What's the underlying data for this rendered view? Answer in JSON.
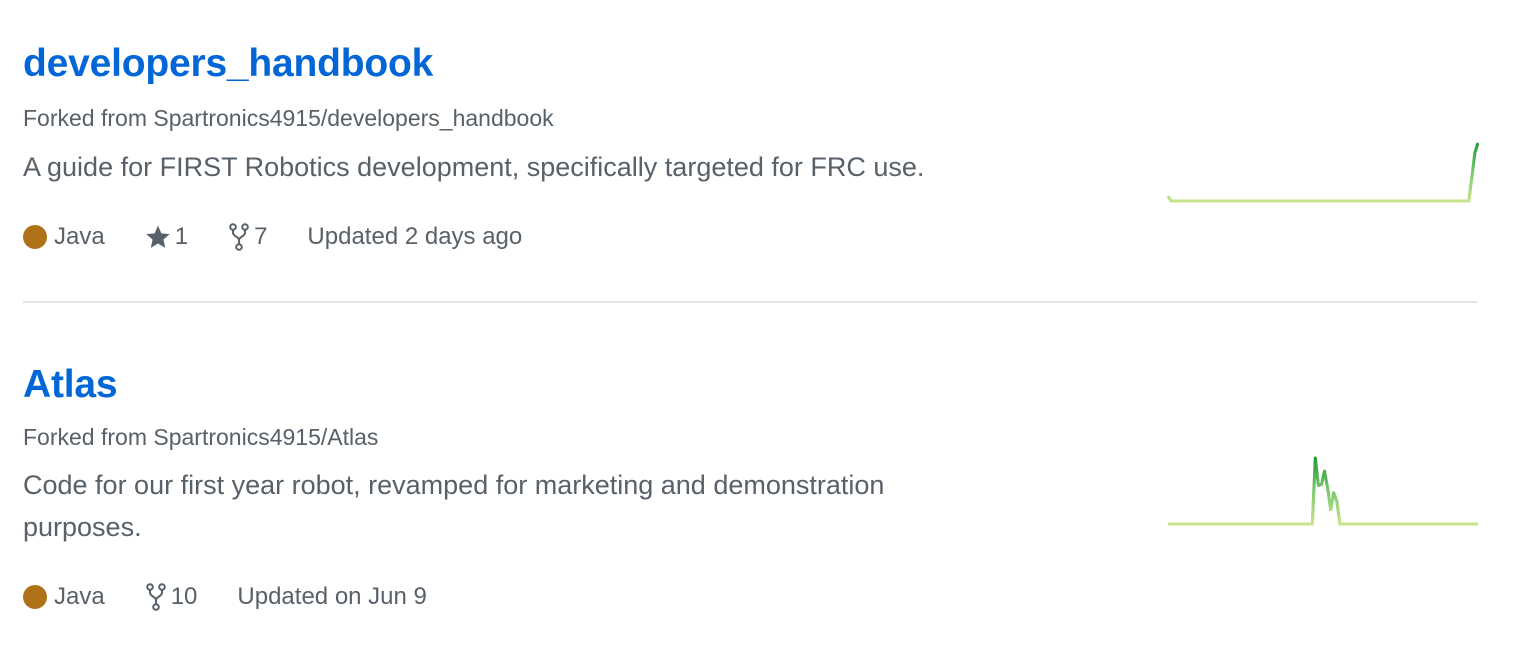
{
  "repos": [
    {
      "name": "developers_handbook",
      "forked_prefix": "Forked from ",
      "forked_from": "Spartronics4915/developers_handbook",
      "description": "A guide for FIRST Robotics development, specifically targeted for FRC use.",
      "language": "Java",
      "language_color": "#b07219",
      "stars": "1",
      "forks": "7",
      "updated": "Updated 2 days ago",
      "activity": [
        1,
        0,
        0,
        0,
        0,
        0,
        0,
        0,
        0,
        0,
        0,
        0,
        0,
        0,
        0,
        0,
        0,
        0,
        0,
        0,
        0,
        0,
        0,
        0,
        0,
        0,
        0,
        0,
        0,
        0,
        0,
        0,
        0,
        0,
        0,
        0,
        0,
        0,
        0,
        0,
        0,
        0,
        0,
        0,
        0,
        0,
        0,
        0,
        0,
        0,
        0,
        0,
        0,
        0,
        0,
        0,
        0,
        0,
        0,
        0,
        0,
        0,
        0,
        0,
        0,
        0,
        0,
        0,
        0,
        0,
        0,
        0,
        0,
        0,
        0,
        0,
        0,
        0,
        0,
        0,
        0,
        0,
        0,
        0,
        0,
        0,
        0,
        0,
        0,
        0,
        0,
        0,
        0,
        0,
        0,
        0,
        0,
        0,
        0,
        5,
        10,
        12
      ]
    },
    {
      "name": "Atlas",
      "forked_prefix": "Forked from ",
      "forked_from": "Spartronics4915/Atlas",
      "description": "Code for our first year robot, revamped for marketing and demonstration purposes.",
      "language": "Java",
      "language_color": "#b07219",
      "forks": "10",
      "updated": "Updated on Jun 9",
      "activity": [
        0,
        0,
        0,
        0,
        0,
        0,
        0,
        0,
        0,
        0,
        0,
        0,
        0,
        0,
        0,
        0,
        0,
        0,
        0,
        0,
        0,
        0,
        0,
        0,
        0,
        0,
        0,
        0,
        0,
        0,
        0,
        0,
        0,
        0,
        0,
        0,
        0,
        0,
        0,
        0,
        0,
        0,
        0,
        0,
        0,
        0,
        0,
        0,
        55,
        32,
        33,
        44,
        30,
        12,
        26,
        19,
        0,
        0,
        0,
        0,
        0,
        0,
        0,
        0,
        0,
        0,
        0,
        0,
        0,
        0,
        0,
        0,
        0,
        0,
        0,
        0,
        0,
        0,
        0,
        0,
        0,
        0,
        0,
        0,
        0,
        0,
        0,
        0,
        0,
        0,
        0,
        0,
        0,
        0,
        0,
        0,
        0,
        0,
        0,
        0,
        0,
        0
      ]
    }
  ],
  "colors": {
    "link": "#0366d6",
    "text_muted": "#586069",
    "divider": "#e1e4e8",
    "spark_low": "#c6e48b",
    "spark_high": "#7bc96f",
    "spark_top": "#239a3b"
  },
  "icons": {
    "star": "star-icon",
    "fork": "fork-icon"
  }
}
